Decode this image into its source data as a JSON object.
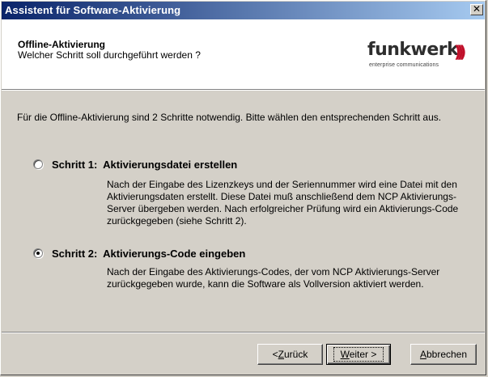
{
  "window": {
    "title": "Assistent für Software-Aktivierung",
    "close_glyph": "✕"
  },
  "header": {
    "title": "Offline-Aktivierung",
    "subtitle": "Welcher Schritt soll durchgeführt werden ?",
    "logo": {
      "word": "funkwerk",
      "tagline": "enterprise communications",
      "waves": ")))"
    }
  },
  "intro": "Für die Offline-Aktivierung sind 2 Schritte notwendig. Bitte wählen den entsprechenden Schritt aus.",
  "options": [
    {
      "label": "Schritt 1:  Aktivierungsdatei erstellen",
      "selected": false,
      "description": "Nach der Eingabe des Lizenzkeys und der Seriennummer wird eine Datei mit den Aktivierungsdaten erstellt. Diese Datei muß anschließend dem NCP Aktivierungs-Server übergeben werden. Nach erfolgreicher Prüfung wird ein Aktivierungs-Code zurückgegeben (siehe Schritt 2)."
    },
    {
      "label": "Schritt 2:  Aktivierungs-Code eingeben",
      "selected": true,
      "description": "Nach der Eingabe des Aktivierungs-Codes, der vom NCP Aktivierungs-Server zurückgegeben wurde, kann die Software als Vollversion aktiviert werden."
    }
  ],
  "buttons": {
    "back": {
      "prefix": "< ",
      "mnemonic": "Z",
      "rest": "urück"
    },
    "next": {
      "mnemonic": "W",
      "rest": "eiter",
      "suffix": " >"
    },
    "cancel": {
      "mnemonic": "A",
      "rest": "bbrechen"
    }
  }
}
